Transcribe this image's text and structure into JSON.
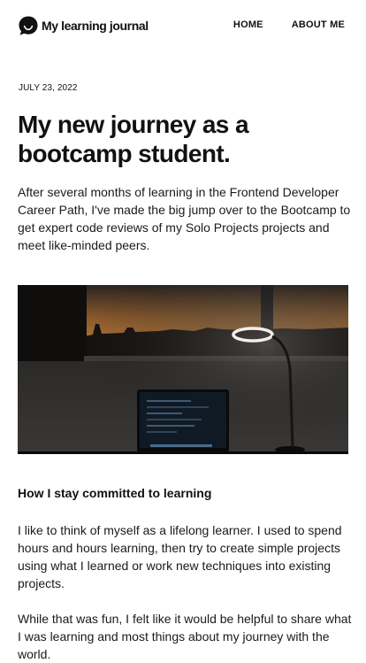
{
  "header": {
    "brand": "My learning journal",
    "logo_icon": "chat-bubble-smile-icon",
    "nav": [
      {
        "label": "HOME"
      },
      {
        "label": "ABOUT ME"
      }
    ]
  },
  "article": {
    "date": "JULY 23, 2022",
    "title": "My new journey as a bootcamp student.",
    "intro": "After several months of learning in the Frontend Developer Career Path, I've made the big jump over to the Bootcamp to get expert code reviews of my Solo Projects projects and meet like-minded peers.",
    "section_heading": "How I stay committed to learning",
    "paragraphs": [
      "I like to think of myself as a lifelong learner. I used to spend hours and hours learning, then try to create simple projects using what I learned or work new techniques into existing projects.",
      "While that was fun, I felt like it would be helpful to share what I was learning and most things about my journey with the world."
    ]
  },
  "colors": {
    "text": "#111111",
    "background": "#ffffff"
  }
}
